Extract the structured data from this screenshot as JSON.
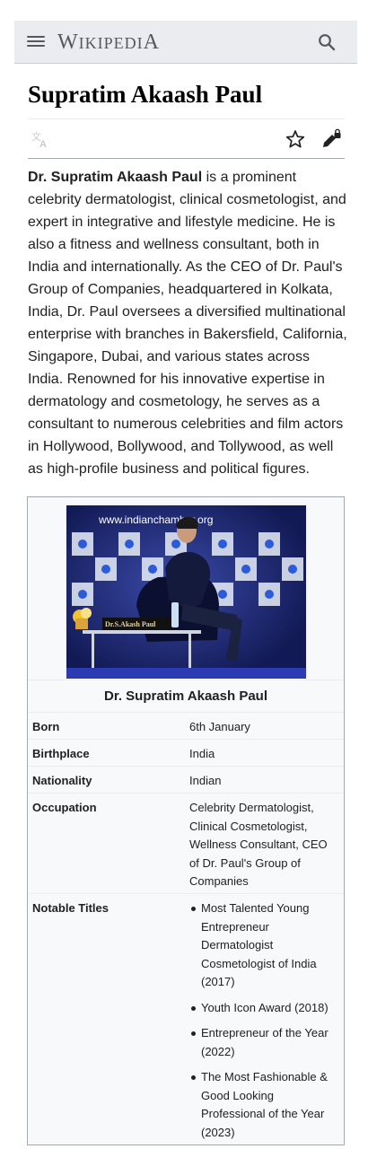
{
  "header": {
    "wordmark": "Wikipedia",
    "wordmark_parts": [
      "W",
      "IKIPEDI",
      "A"
    ],
    "menu_icon": "hamburger-menu-icon",
    "search_icon": "search-icon"
  },
  "page": {
    "title": "Supratim Akaash Paul",
    "actions": {
      "language_icon": "language-translate-icon",
      "watch_icon": "star-icon",
      "edit_icon": "pencil-lock-icon"
    },
    "lead": {
      "bold_name": "Dr. Supratim Akaash Paul",
      "text": " is a prominent celebrity dermatologist, clinical cosmetologist, and expert in integrative and lifestyle medicine. He is also a fitness and wellness consultant, both in India and internationally. As the CEO of Dr. Paul's Group of Companies, headquartered in Kolkata, India, Dr. Paul oversees a diversified multinational enterprise with branches in Bakersfield, California, Singapore, Dubai, and various states across India. Renowned for his innovative expertise in dermatology and cosmetology, he serves as a consultant to numerous celebrities and film actors in Hollywood, Bollywood, and Tollywood, as well as high-profile business and political figures."
    }
  },
  "infobox": {
    "photo": {
      "banner_text": "www.indianchamber.org",
      "nameplate": "Dr.S.Akash Paul"
    },
    "caption": "Dr. Supratim Akaash Paul",
    "rows": [
      {
        "label": "Born",
        "value": "6th January"
      },
      {
        "label": "Birthplace",
        "value": "India"
      },
      {
        "label": "Nationality",
        "value": "Indian"
      },
      {
        "label": "Occupation",
        "value": "Celebrity Dermatologist, Clinical Cosmetologist, Wellness Consultant, CEO of Dr. Paul's Group of Companies"
      },
      {
        "label": "Notable Titles",
        "items": [
          "Most Talented Young Entrepreneur Dermatologist Cosmetologist of India (2017)",
          "Youth Icon Award (2018)",
          "Entrepreneur of the Year (2022)",
          "The Most Fashionable & Good Looking Professional of the Year (2023)"
        ]
      }
    ]
  },
  "colors": {
    "header_bg": "#eaecf0",
    "icon_gray": "#54595d",
    "text": "#202122",
    "infobox_bg": "#f8f9fa",
    "infobox_border": "#a2a9b1",
    "photo_bg": "#1c2361"
  }
}
